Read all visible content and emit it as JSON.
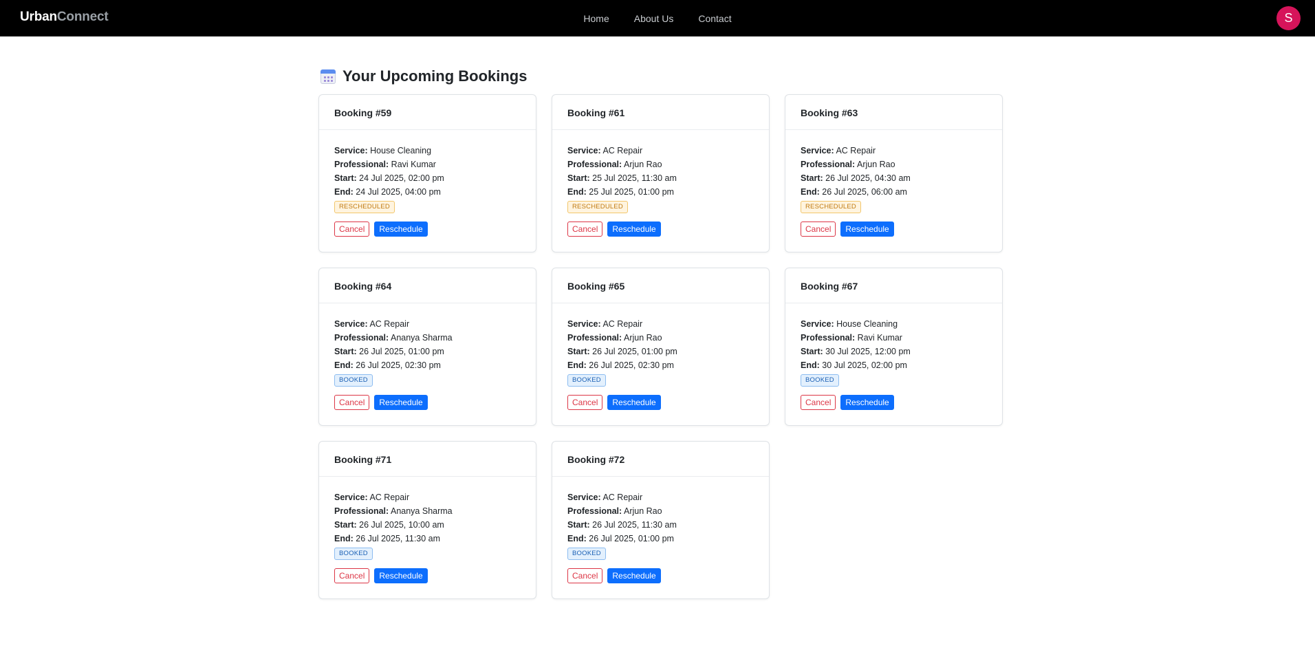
{
  "nav": {
    "brand_part1": "Urban",
    "brand_part2": "Connect",
    "links": [
      "Home",
      "About Us",
      "Contact"
    ],
    "avatar_initial": "S"
  },
  "page": {
    "title": "Your Upcoming Bookings",
    "title_icon": "calendar-icon"
  },
  "labels": {
    "service": "Service:",
    "professional": "Professional:",
    "start": "Start:",
    "end": "End:",
    "cancel": "Cancel",
    "reschedule": "Reschedule"
  },
  "colors": {
    "navbar_bg": "#000000",
    "avatar_bg": "#d6145a",
    "primary": "#0d6efd",
    "danger": "#dc3545",
    "rescheduled_badge": "#c07a10",
    "booked_badge": "#1a5fb4"
  },
  "bookings": [
    {
      "title": "Booking #59",
      "service": "House Cleaning",
      "professional": "Ravi Kumar",
      "start": "24 Jul 2025, 02:00 pm",
      "end": "24 Jul 2025, 04:00 pm",
      "status": "RESCHEDULED"
    },
    {
      "title": "Booking #61",
      "service": "AC Repair",
      "professional": "Arjun Rao",
      "start": "25 Jul 2025, 11:30 am",
      "end": "25 Jul 2025, 01:00 pm",
      "status": "RESCHEDULED"
    },
    {
      "title": "Booking #63",
      "service": "AC Repair",
      "professional": "Arjun Rao",
      "start": "26 Jul 2025, 04:30 am",
      "end": "26 Jul 2025, 06:00 am",
      "status": "RESCHEDULED"
    },
    {
      "title": "Booking #64",
      "service": "AC Repair",
      "professional": "Ananya Sharma",
      "start": "26 Jul 2025, 01:00 pm",
      "end": "26 Jul 2025, 02:30 pm",
      "status": "BOOKED"
    },
    {
      "title": "Booking #65",
      "service": "AC Repair",
      "professional": "Arjun Rao",
      "start": "26 Jul 2025, 01:00 pm",
      "end": "26 Jul 2025, 02:30 pm",
      "status": "BOOKED"
    },
    {
      "title": "Booking #67",
      "service": "House Cleaning",
      "professional": "Ravi Kumar",
      "start": "30 Jul 2025, 12:00 pm",
      "end": "30 Jul 2025, 02:00 pm",
      "status": "BOOKED"
    },
    {
      "title": "Booking #71",
      "service": "AC Repair",
      "professional": "Ananya Sharma",
      "start": "26 Jul 2025, 10:00 am",
      "end": "26 Jul 2025, 11:30 am",
      "status": "BOOKED"
    },
    {
      "title": "Booking #72",
      "service": "AC Repair",
      "professional": "Arjun Rao",
      "start": "26 Jul 2025, 11:30 am",
      "end": "26 Jul 2025, 01:00 pm",
      "status": "BOOKED"
    }
  ]
}
